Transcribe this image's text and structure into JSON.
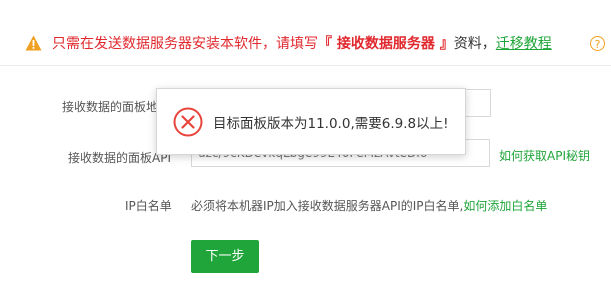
{
  "notice": {
    "text1": "只需在发送数据服务器安装本软件，请填写",
    "text2": "『 接收数据服务器 』",
    "text3": "资料，",
    "link": "迁移教程",
    "help": "?"
  },
  "form": {
    "field1_label": "接收数据的面板地",
    "field1_value": "",
    "field2_label": "接收数据的面板API",
    "field2_value": "uzc/9cKDevkqLbge99L40PeMzAvteDI6",
    "get_api_link": "如何获取API秘钥",
    "ip_label": "IP白名单",
    "ip_hint": "必须将本机器IP加入接收数据服务器API的IP白名单,",
    "ip_link": "如何添加白名单",
    "next_button": "下一步"
  },
  "toast": {
    "message": "目标面板版本为11.0.0,需要6.9.8以上!"
  },
  "colors": {
    "warning": "#e0282e",
    "accent": "#20a53a",
    "error": "#e8463c"
  }
}
